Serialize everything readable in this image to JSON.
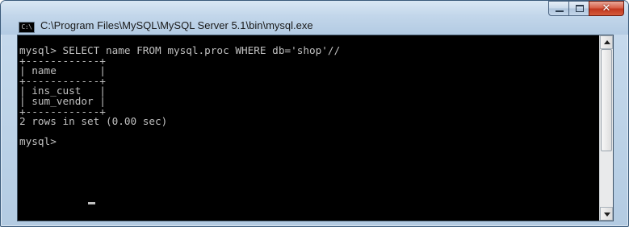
{
  "window": {
    "title": "C:\\Program Files\\MySQL\\MySQL Server 5.1\\bin\\mysql.exe",
    "icon_label": "C:\\",
    "colors": {
      "console_bg": "#000000",
      "console_text": "#c0c0c0",
      "close_button": "#c8432a"
    }
  },
  "console": {
    "lines": [
      "mysql> SELECT name FROM mysql.proc WHERE db='shop'//",
      "+------------+",
      "| name       |",
      "+------------+",
      "| ins_cust   |",
      "| sum_vendor |",
      "+------------+",
      "2 rows in set (0.00 sec)",
      "",
      "mysql> "
    ]
  },
  "controls": {
    "minimize_icon": "minimize-icon",
    "maximize_icon": "maximize-icon",
    "close_icon": "close-icon"
  }
}
